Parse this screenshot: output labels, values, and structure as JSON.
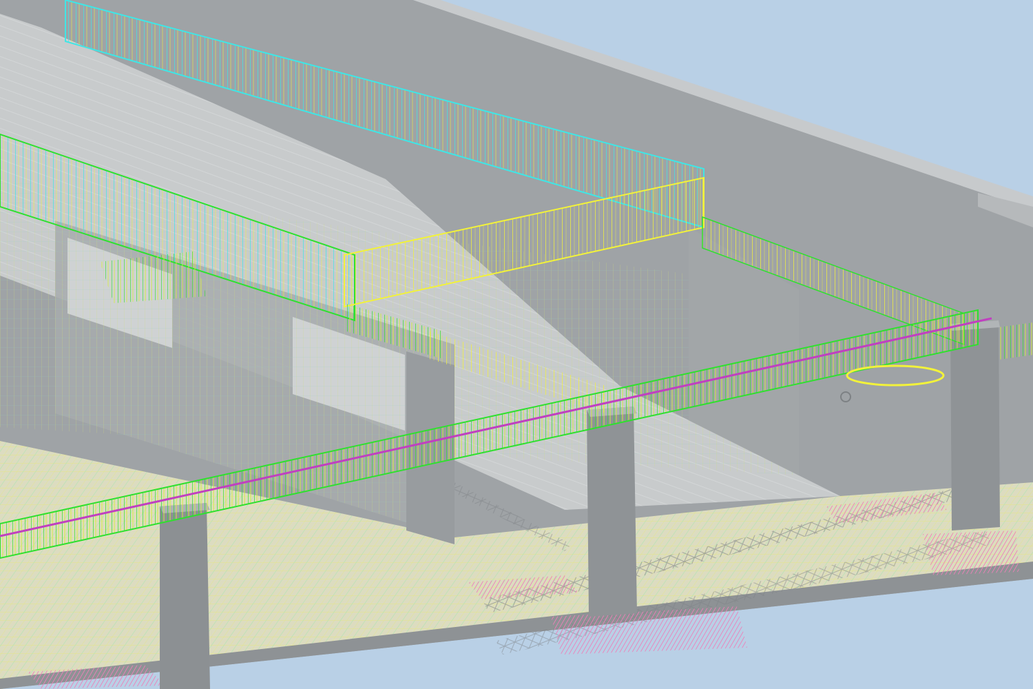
{
  "scene": {
    "description_free": true,
    "colors": {
      "sky": "#b9d0e6",
      "concrete_light": "#c9ccce",
      "concrete_mid": "#a9acae",
      "concrete_dark": "#8f9396",
      "slab_top": "#d8d9c6",
      "rebar_yellow": "#f2f23a",
      "rebar_green": "#2fe02f",
      "rebar_cyan": "#3fe6e6",
      "rebar_magenta": "#c040c0",
      "rebar_pink": "#f07ab4",
      "grid_mesh": "#e2e48c"
    }
  }
}
